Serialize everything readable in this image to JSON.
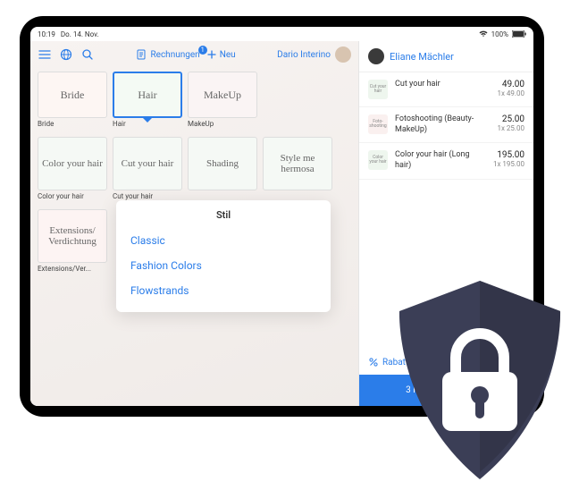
{
  "statusbar": {
    "time": "10:19",
    "date": "Do. 14. Nov.",
    "battery": "100%"
  },
  "toolbar": {
    "rechnungen": "Rechnungen",
    "rechnungen_badge": "1",
    "neu": "Neu",
    "user_main": "Dario Interino",
    "user_side": "Eliane Mächler"
  },
  "categories": [
    {
      "tile": "Bride",
      "label": "Bride"
    },
    {
      "tile": "Hair",
      "label": "Hair"
    },
    {
      "tile": "MakeUp",
      "label": "MakeUp"
    }
  ],
  "services_row1": [
    {
      "tile": "Color your hair",
      "label": "Color your hair"
    },
    {
      "tile": "Cut your hair",
      "label": "Cut your hair"
    },
    {
      "tile": "Shading",
      "label": ""
    },
    {
      "tile": "Style me hermosa",
      "label": ""
    }
  ],
  "services_row2": [
    {
      "tile": "Extensions/ Verdichtung",
      "label": "Extensions/Ver..."
    }
  ],
  "popup": {
    "title": "Stil",
    "items": [
      "Classic",
      "Fashion Colors",
      "Flowstrands"
    ]
  },
  "cart": [
    {
      "thumb": "Cut your hair",
      "name": "Cut your hair",
      "amount": "49.00",
      "qty": "1x 49.00",
      "tone": "g"
    },
    {
      "thumb": "Foto-shooting",
      "name": "Fotoshooting (Beauty-MakeUp)",
      "amount": "25.00",
      "qty": "1x 25.00",
      "tone": "p"
    },
    {
      "thumb": "Color your hair",
      "name": "Color your hair (Long hair)",
      "amount": "195.00",
      "qty": "1x 195.00",
      "tone": "g"
    }
  ],
  "footer": {
    "rabatt": "Rabatt",
    "checkout": "3 Produkte bezahlen"
  }
}
